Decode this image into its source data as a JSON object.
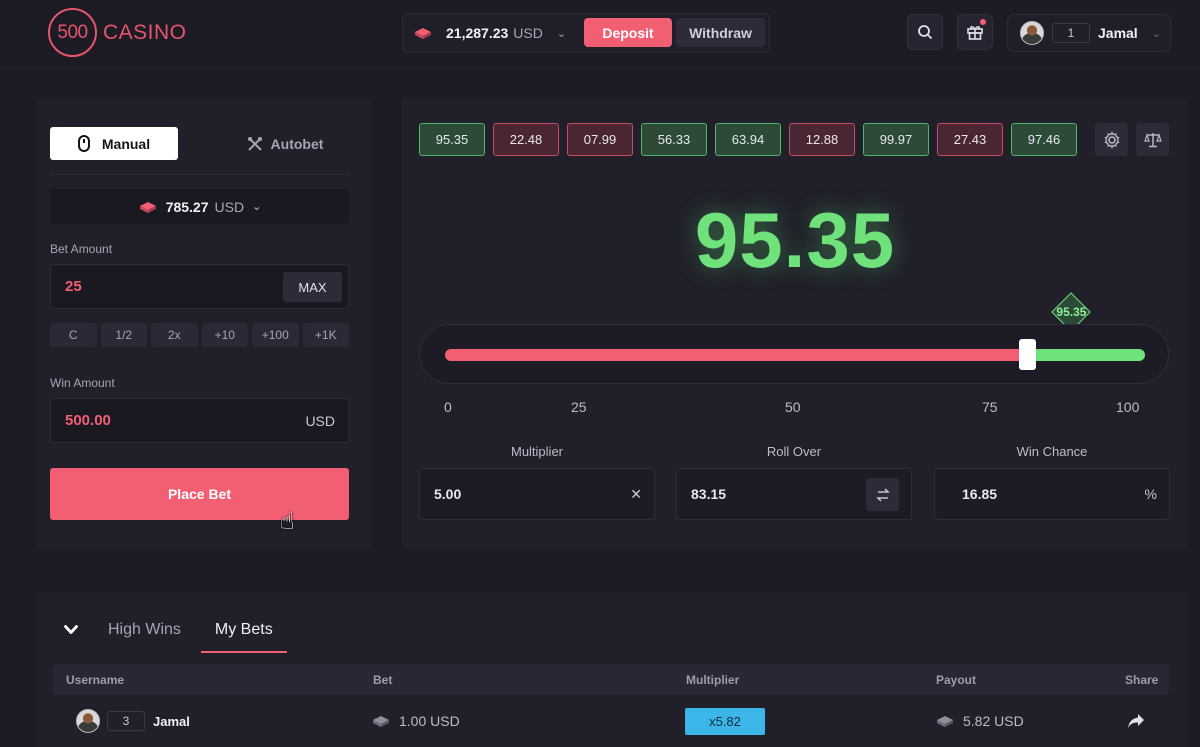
{
  "header": {
    "logo_number": "500",
    "logo_word": "CASINO",
    "balance": "21,287.23",
    "currency": "USD",
    "deposit_label": "Deposit",
    "withdraw_label": "Withdraw",
    "user": {
      "level": "1",
      "name": "Jamal"
    }
  },
  "bet_panel": {
    "tabs": {
      "manual": "Manual",
      "autobet": "Autobet"
    },
    "balance": "785.27",
    "currency": "USD",
    "bet_amount_label": "Bet Amount",
    "bet_amount_value": "25",
    "max_label": "MAX",
    "chips": [
      "C",
      "1/2",
      "2x",
      "+10",
      "+100",
      "+1K"
    ],
    "win_amount_label": "Win Amount",
    "win_amount_value": "500.00",
    "win_currency": "USD",
    "place_bet_label": "Place Bet"
  },
  "game": {
    "history": [
      {
        "value": "95.35",
        "result": "win"
      },
      {
        "value": "22.48",
        "result": "loss"
      },
      {
        "value": "07.99",
        "result": "loss"
      },
      {
        "value": "56.33",
        "result": "win"
      },
      {
        "value": "63.94",
        "result": "win"
      },
      {
        "value": "12.88",
        "result": "loss"
      },
      {
        "value": "99.97",
        "result": "win"
      },
      {
        "value": "27.43",
        "result": "loss"
      },
      {
        "value": "97.46",
        "result": "win"
      }
    ],
    "result": "95.35",
    "marker_value": "95.35",
    "roll_over_threshold": 83.15,
    "scale": [
      "0",
      "25",
      "50",
      "75",
      "100"
    ],
    "multiplier_label": "Multiplier",
    "multiplier_value": "5.00",
    "multiplier_suffix": "✕",
    "roll_over_label": "Roll Over",
    "roll_over_value": "83.15",
    "win_chance_label": "Win Chance",
    "win_chance_value": "16.85",
    "win_chance_suffix": "%",
    "colors": {
      "win": "#6fe27c",
      "loss": "#f25f73"
    }
  },
  "bets": {
    "tabs": {
      "high_wins": "High Wins",
      "my_bets": "My Bets"
    },
    "columns": [
      "Username",
      "Bet",
      "Multiplier",
      "Payout",
      "Share"
    ],
    "rows": [
      {
        "level": "3",
        "username": "Jamal",
        "bet": "1.00 USD",
        "multiplier": "x5.82",
        "payout": "5.82 USD"
      }
    ]
  }
}
